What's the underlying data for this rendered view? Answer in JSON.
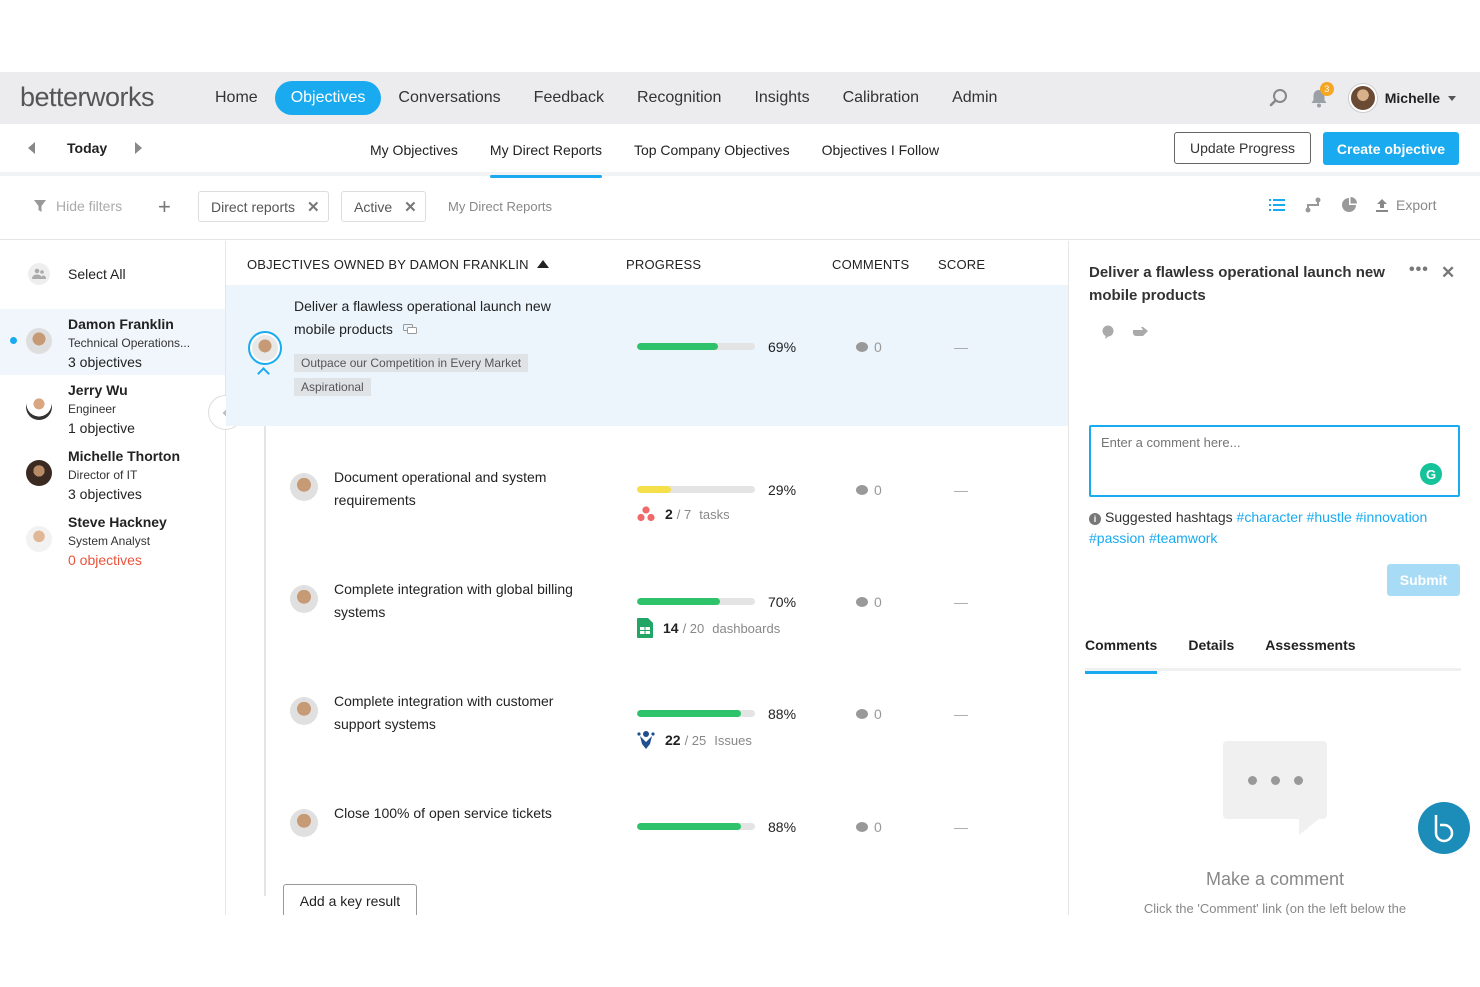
{
  "brand": {
    "logo_text": "betterworks",
    "accent": "#1aaaf0"
  },
  "nav": {
    "items": [
      "Home",
      "Objectives",
      "Conversations",
      "Feedback",
      "Recognition",
      "Insights",
      "Calibration",
      "Admin"
    ],
    "active": "Objectives",
    "notifications_count": "3",
    "user_name": "Michelle"
  },
  "subnav": {
    "date_label": "Today",
    "tabs": [
      "My Objectives",
      "My Direct Reports",
      "Top Company Objectives",
      "Objectives I Follow"
    ],
    "active_tab": "My Direct Reports",
    "update_progress_label": "Update Progress",
    "create_objective_label": "Create objective"
  },
  "filters": {
    "hide_filters_label": "Hide filters",
    "chips": [
      "Direct reports",
      "Active"
    ],
    "label": "My Direct Reports",
    "export_label": "Export"
  },
  "people": {
    "select_all_label": "Select All",
    "list": [
      {
        "name": "Damon Franklin",
        "role": "Technical Operations...",
        "count": "3 objectives",
        "selected": true
      },
      {
        "name": "Jerry Wu",
        "role": "Engineer",
        "count": "1 objective",
        "selected": false
      },
      {
        "name": "Michelle Thorton",
        "role": "Director of IT",
        "count": "3 objectives",
        "selected": false
      },
      {
        "name": "Steve Hackney",
        "role": "System Analyst",
        "count": "0 objectives",
        "selected": false
      }
    ]
  },
  "table": {
    "headers": {
      "owner": "OBJECTIVES OWNED BY DAMON FRANKLIN",
      "progress": "PROGRESS",
      "comments": "COMMENTS",
      "score": "SCORE"
    },
    "objective": {
      "title": "Deliver a flawless operational launch new mobile products",
      "tags": [
        "Outpace our Competition in Every Market",
        "Aspirational"
      ],
      "progress": 69,
      "progress_label": "69%",
      "comments": "0",
      "score": "—"
    },
    "key_results": [
      {
        "title": "Document operational and system requirements",
        "progress": 29,
        "progress_label": "29%",
        "color": "#f5e04a",
        "metric_num": "2",
        "metric_total": "/ 7",
        "metric_unit": "tasks",
        "metric_icon": "asana-icon",
        "comments": "0",
        "score": "—"
      },
      {
        "title": "Complete integration with global billing systems",
        "progress": 70,
        "progress_label": "70%",
        "color": "#2ec36b",
        "metric_num": "14",
        "metric_total": "/ 20",
        "metric_unit": "dashboards",
        "metric_icon": "sheets-icon",
        "comments": "0",
        "score": "—"
      },
      {
        "title": "Complete integration with customer support systems",
        "progress": 88,
        "progress_label": "88%",
        "color": "#2ec36b",
        "metric_num": "22",
        "metric_total": "/ 25",
        "metric_unit": "Issues",
        "metric_icon": "jira-icon",
        "comments": "0",
        "score": "—"
      },
      {
        "title": "Close 100% of open service tickets",
        "progress": 88,
        "progress_label": "88%",
        "color": "#2ec36b",
        "comments": "0",
        "score": "—"
      }
    ],
    "add_key_result_label": "Add a key result"
  },
  "panel": {
    "title": "Deliver a flawless operational launch new mobile products",
    "comment_placeholder": "Enter a comment here...",
    "suggested_label": "Suggested hashtags",
    "hashtags": [
      "#character",
      "#hustle",
      "#innovation",
      "#passion",
      "#teamwork"
    ],
    "submit_label": "Submit",
    "tabs": [
      "Comments",
      "Details",
      "Assessments"
    ],
    "active_tab": "Comments",
    "empty_title": "Make a comment",
    "empty_sub": "Click the 'Comment' link (on the left below the"
  }
}
